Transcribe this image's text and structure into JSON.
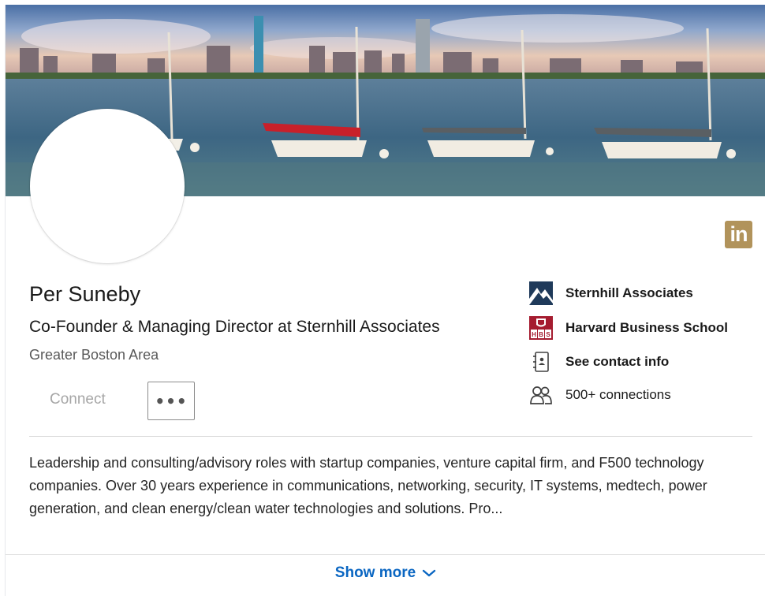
{
  "profile": {
    "name": "Per Suneby",
    "headline": "Co-Founder & Managing Director at Sternhill Associates",
    "location": "Greater Boston Area"
  },
  "actions": {
    "connect_label": "Connect",
    "more_label": "•••"
  },
  "badge": {
    "text": "in",
    "icon": "linkedin-icon",
    "color": "#b1935b"
  },
  "sidebar": {
    "items": [
      {
        "label": "Sternhill Associates",
        "icon": "company-logo-icon"
      },
      {
        "label": "Harvard Business School",
        "icon": "school-logo-icon",
        "logo_text": "HBS"
      },
      {
        "label": "See contact info",
        "icon": "contact-card-icon"
      },
      {
        "label": "500+ connections",
        "icon": "people-icon"
      }
    ]
  },
  "summary": {
    "text": "Leadership and consulting/advisory roles with startup companies, venture capital firm, and F500 technology companies. Over 30 years experience in communications, networking, security, IT systems, medtech, power generation, and clean energy/clean water technologies and solutions. Pro..."
  },
  "footer": {
    "show_more_label": "Show more",
    "icon": "chevron-down-icon"
  },
  "colors": {
    "link": "#0a66c2",
    "muted": "#595959",
    "hbs_red": "#a51c30",
    "sternhill_navy": "#1f3a5a"
  }
}
